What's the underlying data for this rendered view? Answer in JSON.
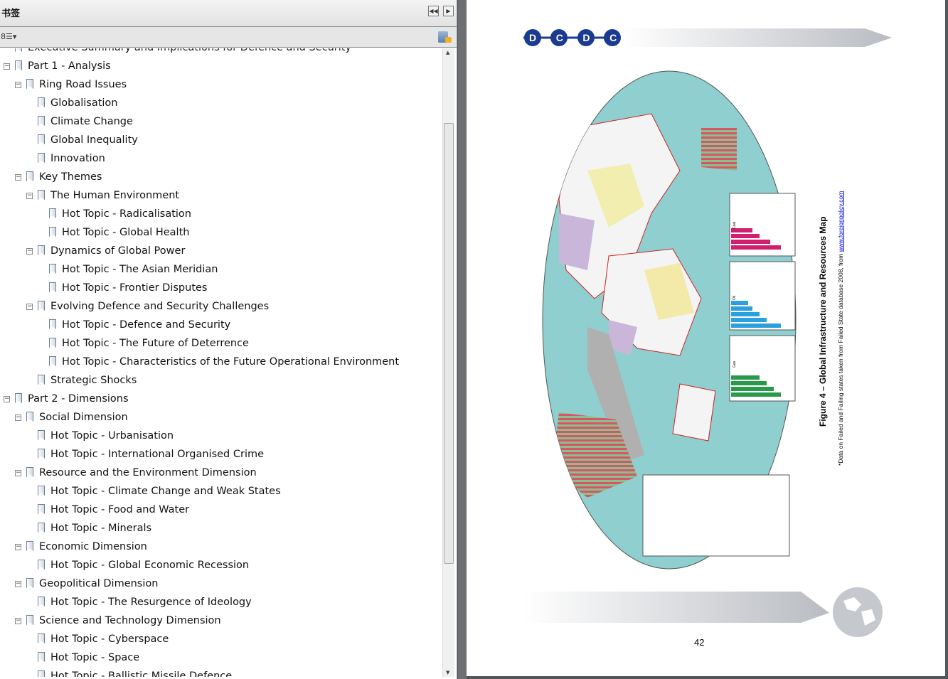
{
  "panel": {
    "title": "书签",
    "collapse_label": "◀◀",
    "expand_label": "▶",
    "options_label": "8☰▾"
  },
  "bookmarks": [
    {
      "label": "Executive Summary and Implications for Defence and Security",
      "level": 0,
      "toggle": ""
    },
    {
      "label": "Part 1 - Analysis",
      "level": 0,
      "toggle": "−"
    },
    {
      "label": "Ring Road Issues",
      "level": 1,
      "toggle": "−"
    },
    {
      "label": "Globalisation",
      "level": 2,
      "toggle": ""
    },
    {
      "label": "Climate Change",
      "level": 2,
      "toggle": ""
    },
    {
      "label": "Global Inequality",
      "level": 2,
      "toggle": ""
    },
    {
      "label": "Innovation",
      "level": 2,
      "toggle": ""
    },
    {
      "label": "Key Themes",
      "level": 1,
      "toggle": "−"
    },
    {
      "label": "The Human Environment",
      "level": 2,
      "toggle": "−"
    },
    {
      "label": "Hot Topic - Radicalisation",
      "level": 3,
      "toggle": ""
    },
    {
      "label": "Hot Topic - Global Health",
      "level": 3,
      "toggle": ""
    },
    {
      "label": "Dynamics of Global Power",
      "level": 2,
      "toggle": "−"
    },
    {
      "label": "Hot Topic - The Asian Meridian",
      "level": 3,
      "toggle": ""
    },
    {
      "label": "Hot Topic - Frontier Disputes",
      "level": 3,
      "toggle": ""
    },
    {
      "label": "Evolving Defence and Security Challenges",
      "level": 2,
      "toggle": "−"
    },
    {
      "label": "Hot Topic - Defence and Security",
      "level": 3,
      "toggle": ""
    },
    {
      "label": "Hot Topic - The Future of Deterrence",
      "level": 3,
      "toggle": ""
    },
    {
      "label": "Hot Topic - Characteristics of the Future Operational Environment",
      "level": 3,
      "toggle": ""
    },
    {
      "label": "Strategic Shocks",
      "level": 2,
      "toggle": ""
    },
    {
      "label": "Part 2 - Dimensions",
      "level": 0,
      "toggle": "−"
    },
    {
      "label": "Social Dimension",
      "level": 1,
      "toggle": "−"
    },
    {
      "label": "Hot Topic - Urbanisation",
      "level": 2,
      "toggle": ""
    },
    {
      "label": "Hot Topic - International Organised Crime",
      "level": 2,
      "toggle": ""
    },
    {
      "label": "Resource and the Environment Dimension",
      "level": 1,
      "toggle": "−"
    },
    {
      "label": "Hot Topic - Climate Change and Weak States",
      "level": 2,
      "toggle": ""
    },
    {
      "label": "Hot Topic - Food and Water",
      "level": 2,
      "toggle": ""
    },
    {
      "label": "Hot Topic - Minerals",
      "level": 2,
      "toggle": ""
    },
    {
      "label": "Economic Dimension",
      "level": 1,
      "toggle": "−"
    },
    {
      "label": "Hot Topic - Global Economic Recession",
      "level": 2,
      "toggle": ""
    },
    {
      "label": "Geopolitical Dimension",
      "level": 1,
      "toggle": "−"
    },
    {
      "label": "Hot Topic - The Resurgence of Ideology",
      "level": 2,
      "toggle": ""
    },
    {
      "label": "Science and Technology Dimension",
      "level": 1,
      "toggle": "−"
    },
    {
      "label": "Hot Topic - Cyberspace",
      "level": 2,
      "toggle": ""
    },
    {
      "label": "Hot Topic - Space",
      "level": 2,
      "toggle": ""
    },
    {
      "label": "Hot Topic - Ballistic Missile Defence",
      "level": 2,
      "toggle": ""
    }
  ],
  "document": {
    "logo": "DCDC",
    "figure_title": "Figure 4 – Global Infrastructure and Resources Map",
    "footnote": "*Data on Failed and Failing states taken from Failed State database 2008, from ",
    "footnote_link": "www.foreignpolicy.com",
    "map_side_labels": [
      "Coal",
      "Oil",
      "Gas"
    ],
    "page_number": "42"
  }
}
